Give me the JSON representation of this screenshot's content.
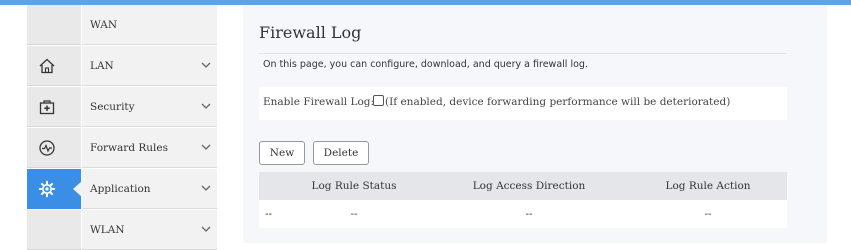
{
  "sidebar": {
    "items": [
      {
        "label": "WAN",
        "icon": "none",
        "has_chevron": false,
        "active": false
      },
      {
        "label": "LAN",
        "icon": "home-icon",
        "has_chevron": true,
        "active": false
      },
      {
        "label": "Security",
        "icon": "security-box-icon",
        "has_chevron": true,
        "active": false
      },
      {
        "label": "Forward Rules",
        "icon": "pulse-circle-icon",
        "has_chevron": true,
        "active": false
      },
      {
        "label": "Application",
        "icon": "gear-icon",
        "has_chevron": true,
        "active": true
      },
      {
        "label": "WLAN",
        "icon": "none",
        "has_chevron": true,
        "active": false
      }
    ]
  },
  "main": {
    "title": "Firewall Log",
    "description": "On this page, you can configure, download, and query a firewall log.",
    "enable": {
      "label": "Enable Firewall Log:",
      "checked": false,
      "note": "(If enabled, device forwarding performance will be deteriorated)"
    },
    "buttons": {
      "new": "New",
      "delete": "Delete"
    },
    "table": {
      "columns": [
        "",
        "Log Rule Status",
        "Log Access Direction",
        "Log Rule Action"
      ],
      "rows": [
        [
          "--",
          "--",
          "--",
          "--"
        ]
      ]
    }
  },
  "colors": {
    "accent": "#3a8ee6",
    "topbar": "#5fa2e6"
  }
}
